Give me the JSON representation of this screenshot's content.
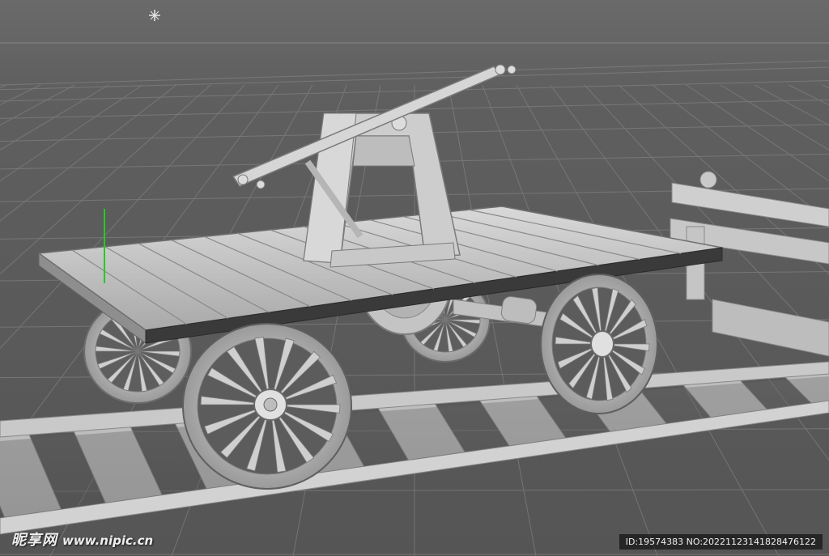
{
  "viewport": {
    "background_color": "#5e5e5e",
    "grid_color": "#8c8c8c",
    "model_color": "#d4d4d4",
    "axis_y_color": "#22cc22",
    "icons": [
      "light-icon",
      "y-axis-gizmo"
    ]
  },
  "model": {
    "object": "rail handcar",
    "parts": [
      "deck",
      "pump-handle",
      "a-frame",
      "gear",
      "axle",
      "front-wheel-left",
      "front-wheel-right",
      "rear-wheel-left",
      "rear-wheel-right",
      "rail-track",
      "sleepers"
    ]
  },
  "watermark": {
    "brand": "昵享网",
    "site": "www.nipic.cn",
    "id_text": "ID:19574383 NO:20221123141828476122"
  }
}
